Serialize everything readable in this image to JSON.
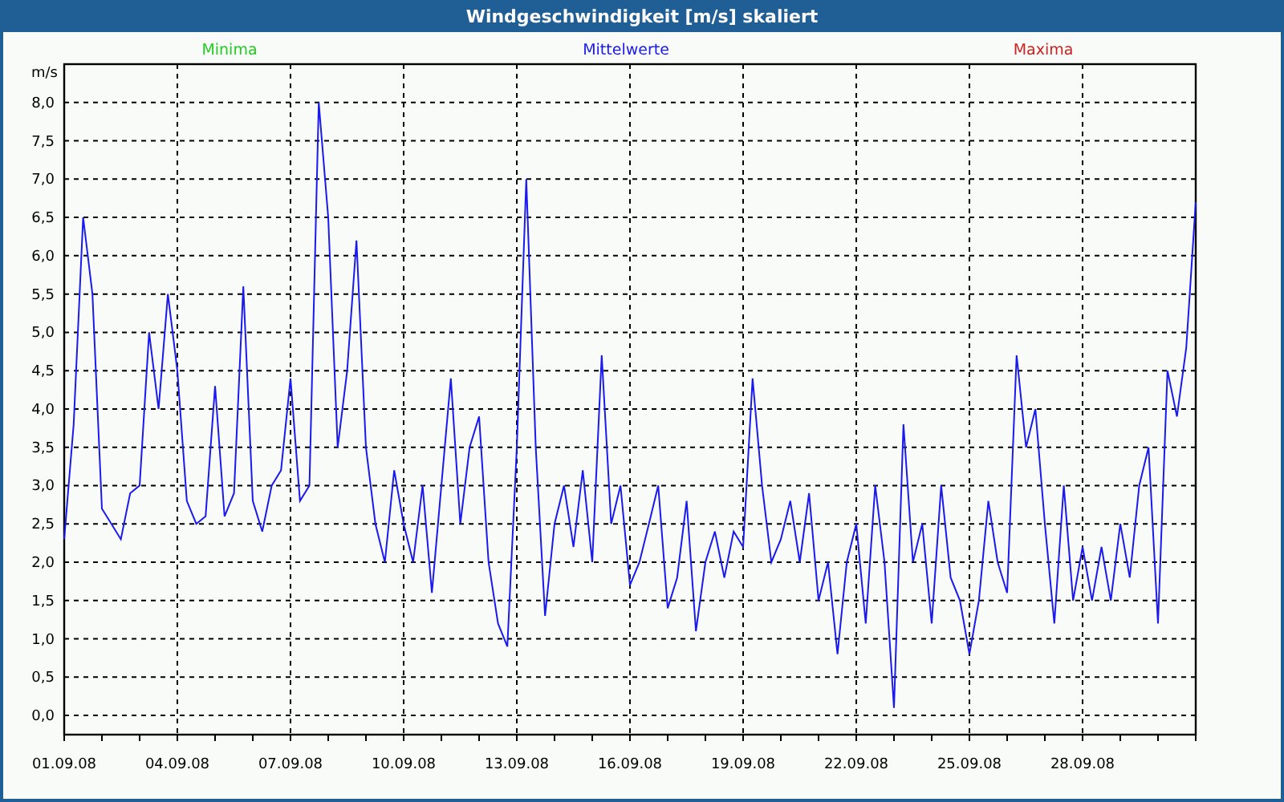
{
  "window": {
    "title": "Windgeschwindigkeit [m/s] skaliert"
  },
  "legend": [
    {
      "label": "Minima",
      "color": "#22cc22"
    },
    {
      "label": "Maxima",
      "color": "#cc2222"
    }
  ],
  "chart_data": {
    "type": "line",
    "grid": true,
    "ylabel": "m/s",
    "ylim": [
      -0.25,
      8.5
    ],
    "categories": [
      "01.09.08",
      null,
      null,
      null,
      null,
      null,
      null,
      null,
      null,
      null,
      null,
      null,
      "04.09.08",
      null,
      null,
      null,
      null,
      null,
      null,
      null,
      null,
      null,
      null,
      null,
      "07.09.08",
      null,
      null,
      null,
      null,
      null,
      null,
      null,
      null,
      null,
      null,
      null,
      "10.09.08",
      null,
      null,
      null,
      null,
      null,
      null,
      null,
      null,
      null,
      null,
      null,
      "13.09.08",
      null,
      null,
      null,
      null,
      null,
      null,
      null,
      null,
      null,
      null,
      null,
      "16.09.08",
      null,
      null,
      null,
      null,
      null,
      null,
      null,
      null,
      null,
      null,
      null,
      "19.09.08",
      null,
      null,
      null,
      null,
      null,
      null,
      null,
      null,
      null,
      null,
      null,
      "22.09.08",
      null,
      null,
      null,
      null,
      null,
      null,
      null,
      null,
      null,
      null,
      null,
      "25.09.08",
      null,
      null,
      null,
      null,
      null,
      null,
      null,
      null,
      null,
      null,
      null,
      "28.09.08",
      null,
      null,
      null,
      null,
      null,
      null,
      null,
      null,
      null,
      null,
      null,
      null
    ],
    "yticks": [
      {
        "value": 0,
        "label": "0,0"
      },
      {
        "value": 0.5,
        "label": "0,5"
      },
      {
        "value": 1,
        "label": "1,0"
      },
      {
        "value": 1.5,
        "label": "1,5"
      },
      {
        "value": 2,
        "label": "2,0"
      },
      {
        "value": 2.5,
        "label": "2,5"
      },
      {
        "value": 3,
        "label": "3,0"
      },
      {
        "value": 3.5,
        "label": "3,5"
      },
      {
        "value": 4,
        "label": "4,0"
      },
      {
        "value": 4.5,
        "label": "4,5"
      },
      {
        "value": 5,
        "label": "5,0"
      },
      {
        "value": 5.5,
        "label": "5,5"
      },
      {
        "value": 6,
        "label": "6,0"
      },
      {
        "value": 6.5,
        "label": "6,5"
      },
      {
        "value": 7,
        "label": "7,0"
      },
      {
        "value": 7.5,
        "label": "7,5"
      },
      {
        "value": 8,
        "label": "8,0"
      }
    ],
    "series": [
      {
        "name": "Mittelwerte",
        "color": "#1a1aee",
        "values": [
          2.3,
          3.8,
          6.5,
          5.5,
          2.7,
          2.5,
          2.3,
          2.9,
          3.0,
          5.0,
          4.0,
          5.5,
          4.5,
          2.8,
          2.5,
          2.6,
          4.3,
          2.6,
          2.9,
          5.6,
          2.8,
          2.4,
          3.0,
          3.2,
          4.4,
          2.8,
          3.0,
          8.0,
          6.5,
          3.5,
          4.5,
          6.2,
          3.5,
          2.5,
          2.0,
          3.2,
          2.5,
          2.0,
          3.0,
          1.6,
          3.0,
          4.4,
          2.5,
          3.5,
          3.9,
          2.0,
          1.2,
          0.9,
          3.5,
          7.0,
          3.5,
          1.3,
          2.5,
          3.0,
          2.2,
          3.2,
          2.0,
          4.7,
          2.5,
          3.0,
          1.7,
          2.0,
          2.5,
          3.0,
          1.4,
          1.8,
          2.8,
          1.1,
          2.0,
          2.4,
          1.8,
          2.4,
          2.2,
          4.4,
          3.0,
          2.0,
          2.3,
          2.8,
          2.0,
          2.9,
          1.5,
          2.0,
          0.8,
          2.0,
          2.5,
          1.2,
          3.0,
          2.0,
          0.1,
          3.8,
          2.0,
          2.5,
          1.2,
          3.0,
          1.8,
          1.5,
          0.8,
          1.5,
          2.8,
          2.0,
          1.6,
          4.7,
          3.5,
          4.0,
          2.5,
          1.2,
          3.0,
          1.5,
          2.2,
          1.5,
          2.2,
          1.5,
          2.5,
          1.8,
          3.0,
          3.5,
          1.2,
          4.5,
          3.9,
          4.8,
          6.7
        ]
      }
    ]
  }
}
